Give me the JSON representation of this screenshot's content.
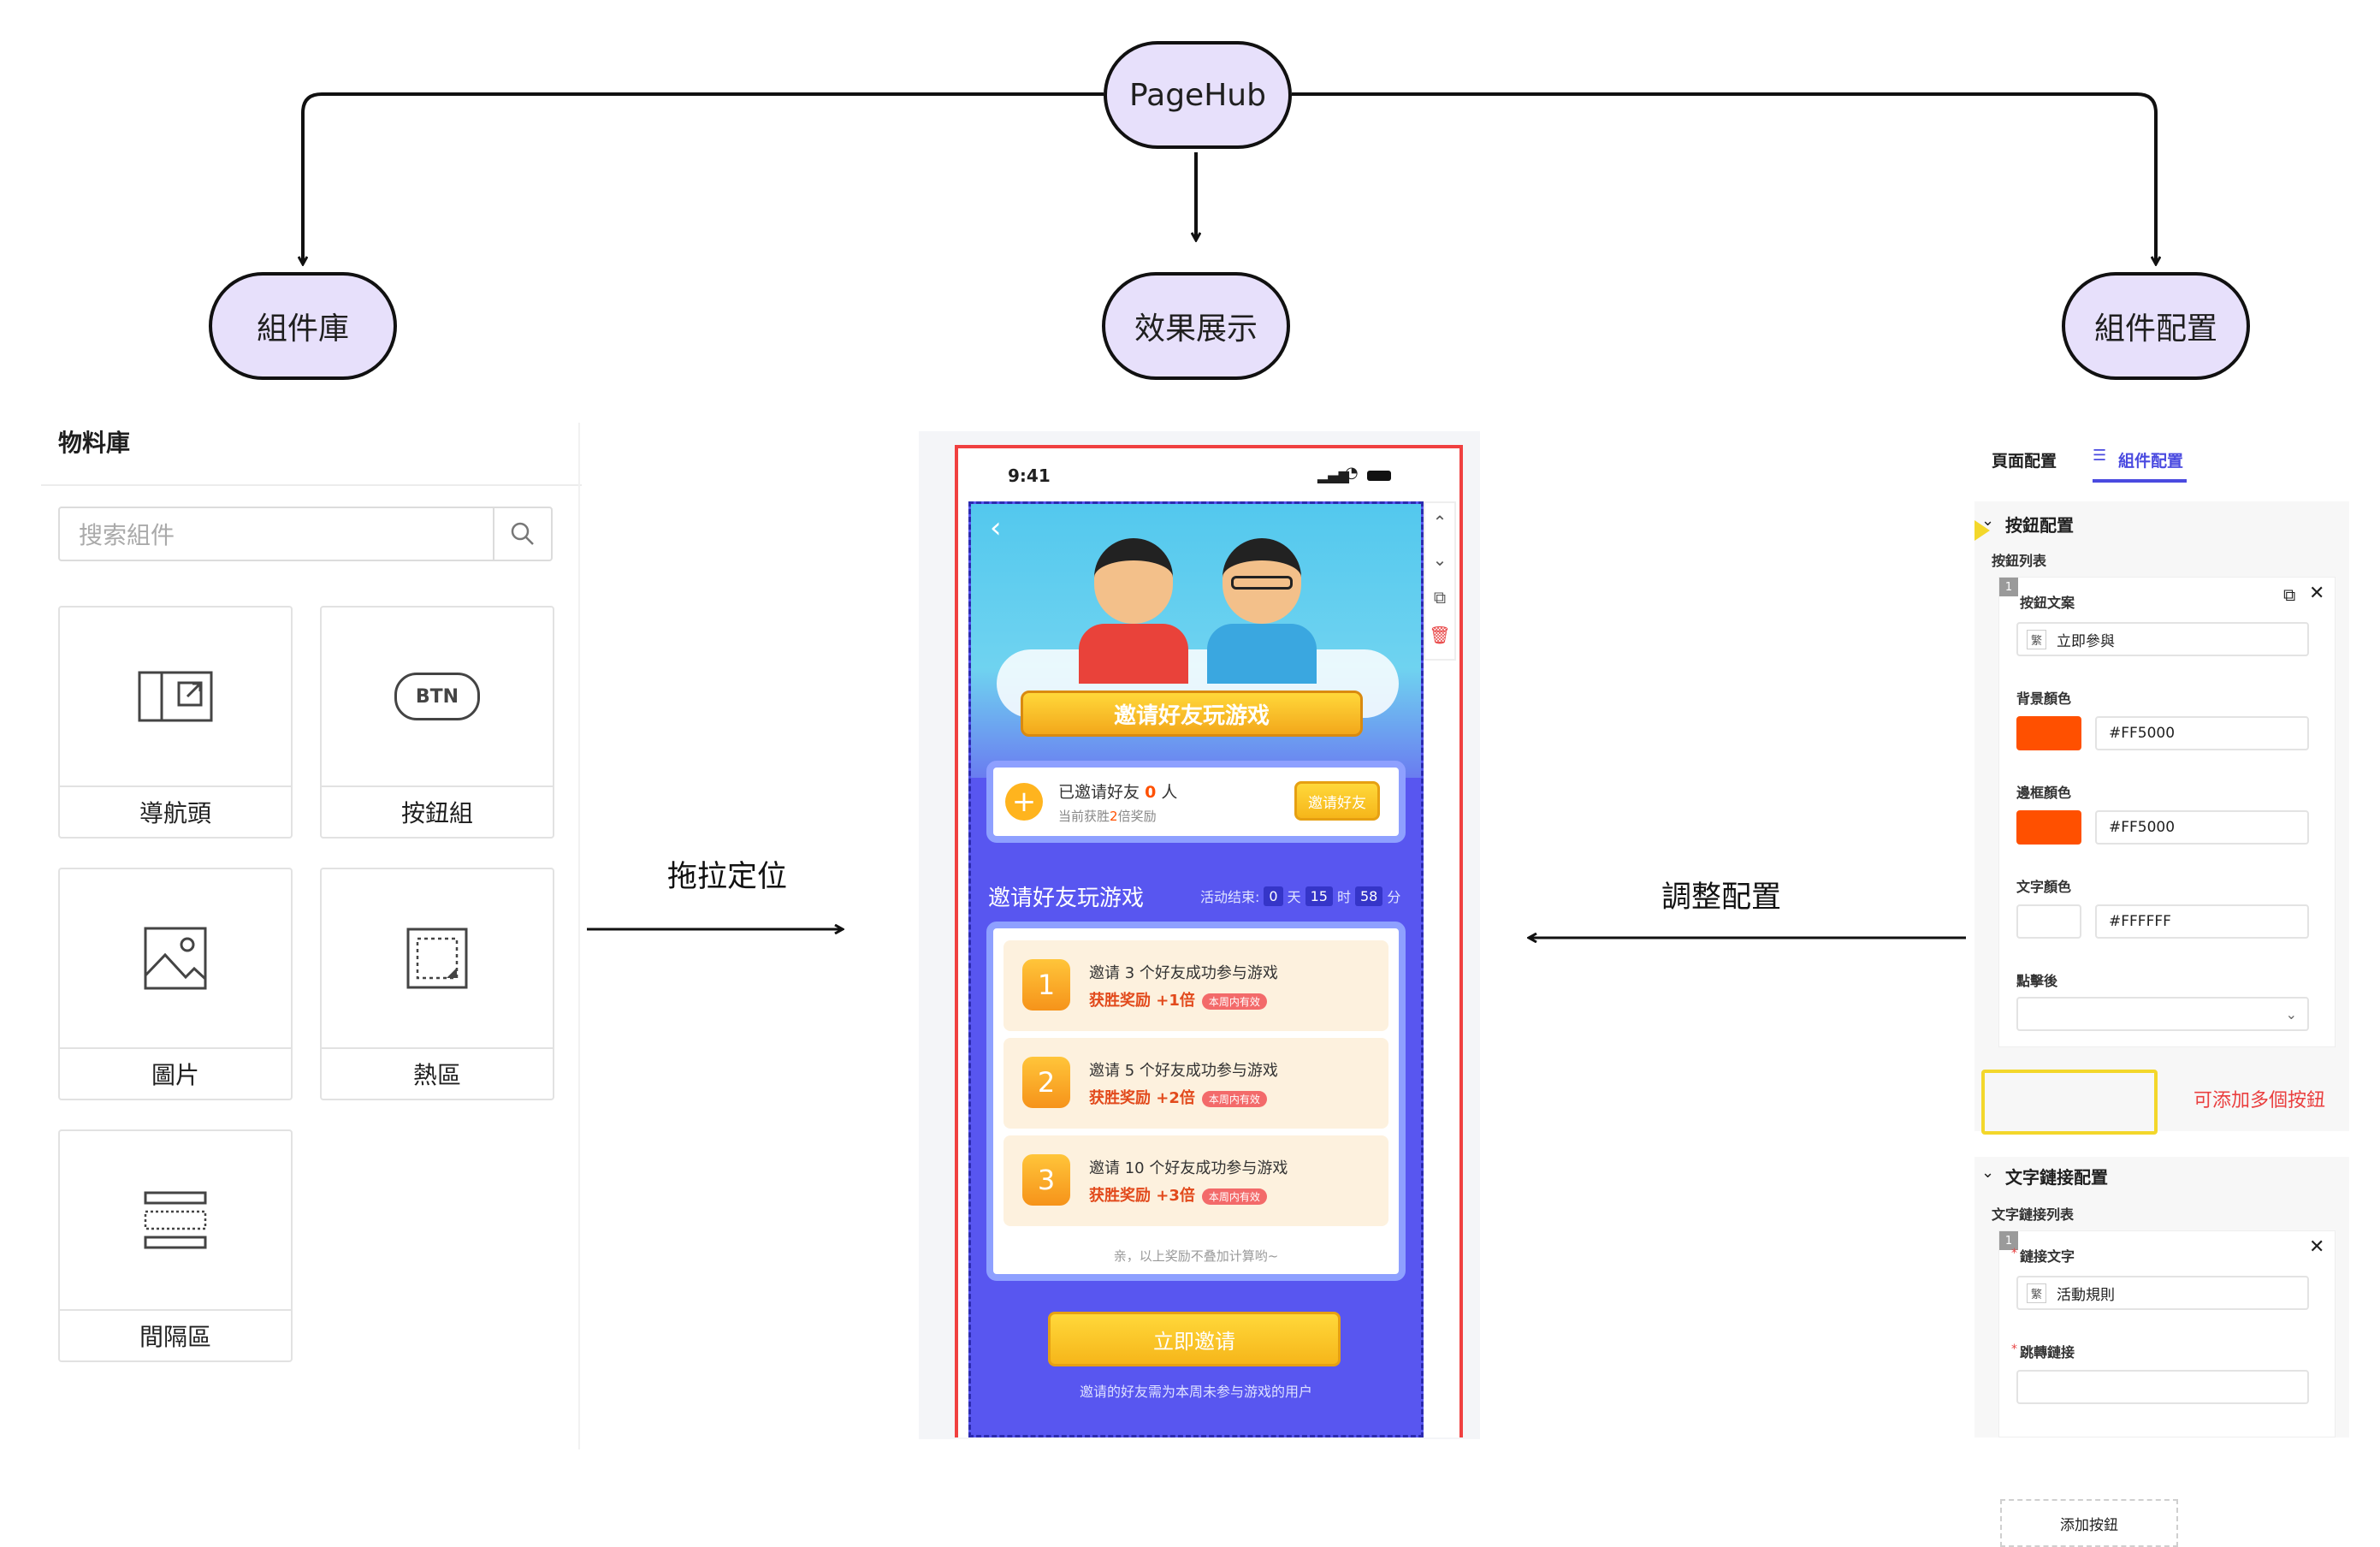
{
  "root": {
    "label": "PageHub"
  },
  "branches": {
    "left": "組件庫",
    "center": "效果展示",
    "right": "組件配置"
  },
  "arrows": {
    "left_label": "拖拉定位",
    "right_label": "調整配置"
  },
  "library": {
    "title": "物料庫",
    "search_placeholder": "搜索組件",
    "items": [
      {
        "name": "導航頭",
        "icon": "navigation-header-icon"
      },
      {
        "name": "按鈕組",
        "icon": "btn-icon",
        "icon_text": "BTN"
      },
      {
        "name": "圖片",
        "icon": "image-icon"
      },
      {
        "name": "熱區",
        "icon": "hotspot-icon"
      },
      {
        "name": "間隔區",
        "icon": "spacer-icon"
      }
    ]
  },
  "preview": {
    "time": "9:41",
    "banner": "邀请好友玩游戏",
    "invited_prefix": "已邀请好友",
    "invited_count": "0",
    "invited_suffix": "人",
    "reward_prefix": "当前获胜",
    "reward_mult": "2",
    "reward_suffix": "倍奖励",
    "invite_button": "邀请好友",
    "section_title": "邀请好友玩游戏",
    "countdown_label": "活动结束:",
    "countdown": [
      {
        "value": "0",
        "unit": "天"
      },
      {
        "value": "15",
        "unit": "时"
      },
      {
        "value": "58",
        "unit": "分"
      }
    ],
    "tasks": [
      {
        "num": "1",
        "line1": "邀请 3 个好友成功参与游戏",
        "line2": "获胜奖励 +1倍",
        "tag": "本周内有效"
      },
      {
        "num": "2",
        "line1": "邀请 5 个好友成功参与游戏",
        "line2": "获胜奖励 +2倍",
        "tag": "本周内有效"
      },
      {
        "num": "3",
        "line1": "邀请 10 个好友成功参与游戏",
        "line2": "获胜奖励 +3倍",
        "tag": "本周内有效"
      }
    ],
    "note": "亲，以上奖励不叠加计算哟~",
    "cta": "立即邀请",
    "cta_note": "邀请的好友需为本周未参与游戏的用户"
  },
  "config": {
    "tabs": [
      "頁面配置",
      "組件配置"
    ],
    "button_group": {
      "title": "按鈕配置",
      "list_label": "按鈕列表",
      "index": "1",
      "text_label": "按鈕文案",
      "trad": "繁",
      "text_value": "立即參與",
      "bg_label": "背景顏色",
      "bg_hex": "#FF5000",
      "border_label": "邊框顏色",
      "border_hex": "#FF5000",
      "textcolor_label": "文字顏色",
      "textcolor_hex": "#FFFFFF",
      "click_label": "點擊後",
      "add_button": "添加按鈕",
      "add_note": "可添加多個按鈕"
    },
    "link_group": {
      "title": "文字鏈接配置",
      "list_label": "文字鏈接列表",
      "index": "1",
      "text_label": "鏈接文字",
      "trad": "繁",
      "text_value": "活動規則",
      "jump_label": "跳轉鏈接"
    }
  },
  "colors": {
    "pill_bg": "#e7e0fb",
    "accent": "#4a4ae0",
    "swatch": "#FF5000",
    "page_bg": "#5856f0",
    "highlight": "#f3d72b"
  }
}
